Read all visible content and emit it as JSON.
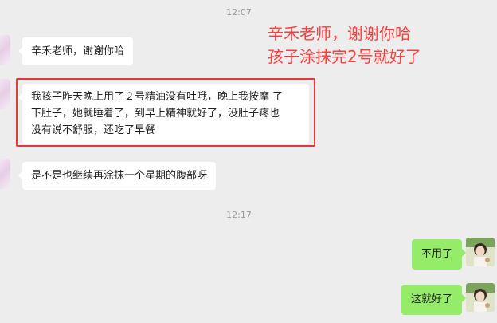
{
  "timestamps": [
    "12:07",
    "12:17"
  ],
  "messages": {
    "m1": "辛禾老师，谢谢你哈",
    "m2_line1": "我孩子昨天晚上用了２号精油没有吐哦，晚上我按摩 了",
    "m2_line2": "下肚子，她就睡着了，到早上精神就好了，没肚子疼也",
    "m2_line3": "没有说不舒服，还吃了早餐",
    "m3": "是不是也继续再涂抹一个星期的腹部呀",
    "r1": "不用了",
    "r2": "这就好了"
  },
  "annotation": {
    "line1": "辛禾老师，谢谢你哈",
    "line2": "孩子涂抹完2号就好了",
    "color": "#ff3b3b"
  },
  "colors": {
    "background": "#ededed",
    "received_bubble": "#ffffff",
    "sent_bubble": "#95ec69",
    "highlight": "#e53935"
  }
}
